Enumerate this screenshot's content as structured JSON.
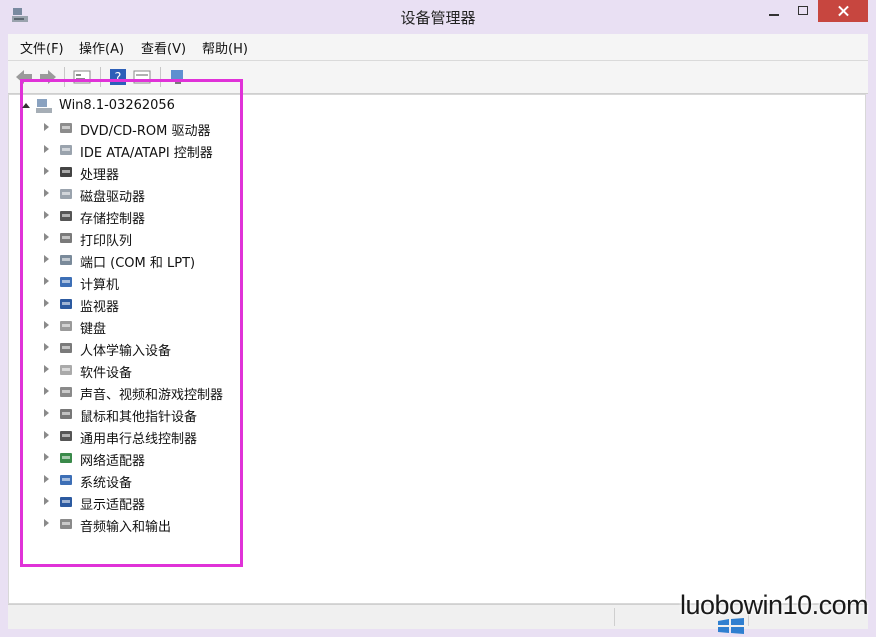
{
  "window": {
    "title": "设备管理器"
  },
  "menu": [
    "文件(F)",
    "操作(A)",
    "查看(V)",
    "帮助(H)"
  ],
  "toolbar": {
    "icons": [
      "back-icon",
      "forward-icon",
      "properties-icon",
      "help-icon",
      "view-icon",
      "scan-hardware-icon"
    ]
  },
  "tree": {
    "root_label": "Win8.1-03262056",
    "items": [
      {
        "label": "DVD/CD-ROM 驱动器",
        "icon": "dvd-drive-icon"
      },
      {
        "label": "IDE ATA/ATAPI 控制器",
        "icon": "ide-controller-icon"
      },
      {
        "label": "处理器",
        "icon": "processor-icon"
      },
      {
        "label": "磁盘驱动器",
        "icon": "disk-drive-icon"
      },
      {
        "label": "存储控制器",
        "icon": "storage-controller-icon"
      },
      {
        "label": "打印队列",
        "icon": "printer-icon"
      },
      {
        "label": "端口 (COM 和 LPT)",
        "icon": "port-icon"
      },
      {
        "label": "计算机",
        "icon": "computer-icon"
      },
      {
        "label": "监视器",
        "icon": "monitor-icon"
      },
      {
        "label": "键盘",
        "icon": "keyboard-icon"
      },
      {
        "label": "人体学输入设备",
        "icon": "hid-icon"
      },
      {
        "label": "软件设备",
        "icon": "software-device-icon"
      },
      {
        "label": "声音、视频和游戏控制器",
        "icon": "speaker-icon"
      },
      {
        "label": "鼠标和其他指针设备",
        "icon": "mouse-icon"
      },
      {
        "label": "通用串行总线控制器",
        "icon": "usb-icon"
      },
      {
        "label": "网络适配器",
        "icon": "network-adapter-icon"
      },
      {
        "label": "系统设备",
        "icon": "system-device-icon"
      },
      {
        "label": "显示适配器",
        "icon": "display-adapter-icon"
      },
      {
        "label": "音频输入和输出",
        "icon": "audio-io-icon"
      }
    ]
  },
  "watermark": "luobowin10.com",
  "colors": {
    "frame": "#e9e0f3",
    "close_button": "#c7463f",
    "highlight_box": "#e032d8"
  }
}
